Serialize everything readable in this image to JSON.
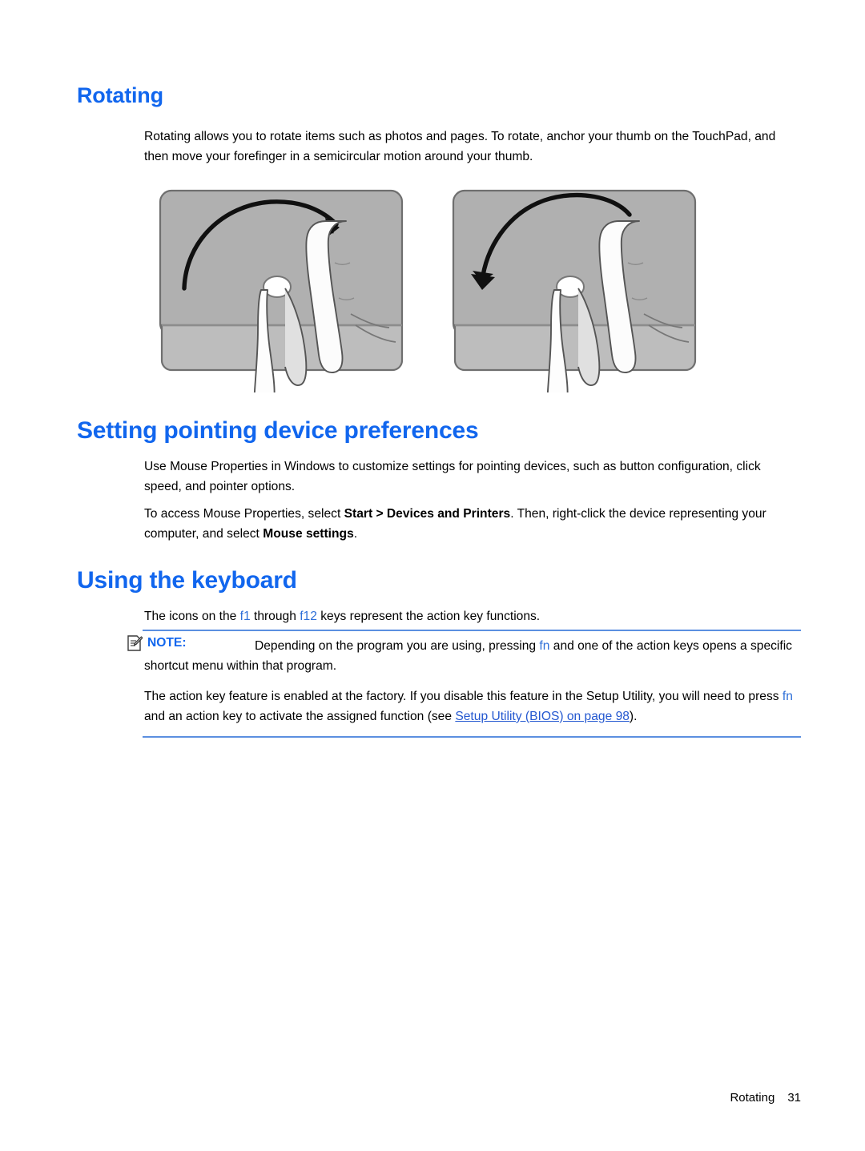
{
  "page": {
    "footer_section": "Rotating",
    "footer_page_number": "31"
  },
  "colors": {
    "heading_blue": "#1166ee",
    "link_blue": "#2458d0",
    "key_ref_blue": "#2e6fd8",
    "rule_blue": "#5b8fe0",
    "touchpad_gray": "#b0b0b0",
    "touchpad_button_gray": "#bdbdbd",
    "outline_gray": "#6f6f6f"
  },
  "sections": {
    "rotating": {
      "heading": "Rotating",
      "paragraph": "Rotating allows you to rotate items such as photos and pages. To rotate, anchor your thumb on the TouchPad, and then move your forefinger in a semicircular motion around your thumb.",
      "figure": {
        "name": "touchpad-rotate-gesture-illustration",
        "panels": [
          {
            "label": "clockwise-rotation",
            "arrow_direction": "clockwise"
          },
          {
            "label": "counterclockwise-rotation",
            "arrow_direction": "counterclockwise"
          }
        ]
      }
    },
    "pointing_device": {
      "heading": "Setting pointing device preferences",
      "paragraph_1": "Use Mouse Properties in Windows to customize settings for pointing devices, such as button configuration, click speed, and pointer options.",
      "paragraph_2": {
        "before": "To access Mouse Properties, select ",
        "bold_1": "Start > Devices and Printers",
        "middle": ". Then, right-click the device representing your computer, and select ",
        "bold_2": "Mouse settings",
        "after": "."
      }
    },
    "keyboard": {
      "heading": "Using the keyboard",
      "paragraph_1": {
        "before": "The icons on the ",
        "key_1": "f1",
        "middle": " through ",
        "key_2": "f12",
        "after": " keys represent the action key functions."
      },
      "note": {
        "icon": "note-document-pencil-icon",
        "label": "NOTE:",
        "text_before": "Depending on the program you are using, pressing ",
        "key": "fn",
        "text_after": " and one of the action keys opens a specific shortcut menu within that program."
      },
      "paragraph_2": {
        "before": "The action key feature is enabled at the factory. If you disable this feature in the Setup Utility, you will need to press ",
        "key": "fn",
        "middle": " and an action key to activate the assigned function (see ",
        "link": "Setup Utility (BIOS) on page 98",
        "after": ")."
      }
    }
  }
}
